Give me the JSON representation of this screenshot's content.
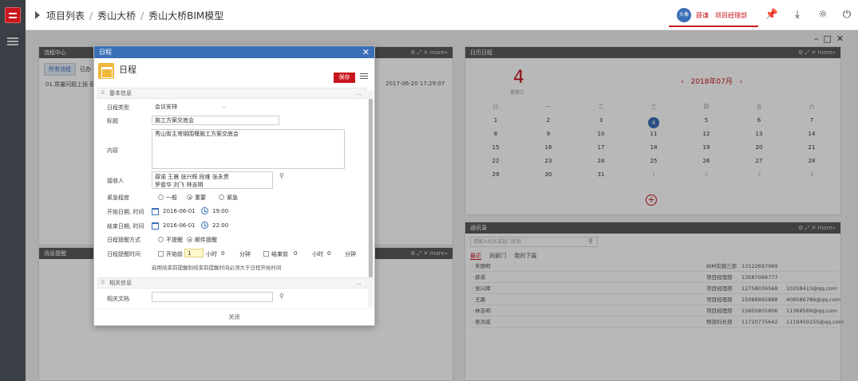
{
  "breadcrumb": [
    "项目列表",
    "秀山大桥",
    "秀山大桥BIM模型"
  ],
  "user": {
    "avatar": "头像",
    "name": "薛谦",
    "role": "项目经理部"
  },
  "header_icons": [
    "pin-icon",
    "download-icon",
    "bulb-icon",
    "power-icon"
  ],
  "colors": {
    "brand_red": "#c8161d",
    "accent_blue": "#3b6fb6",
    "rail_bg": "#3a3f46"
  },
  "process_panel": {
    "title": "流程中心",
    "tabs": [
      "所有流程",
      "已办"
    ],
    "row_text": "01.质量问题上报 薛",
    "row_date": "2017-06-20  17:29:07"
  },
  "remind_panel": {
    "title": "消息提醒"
  },
  "panel_tools": "⚙ ⤢ ✕ more»",
  "calendar": {
    "title": "日历日程",
    "day": "4",
    "weekday": "星期三",
    "month_label": "2018年07月",
    "weekdays": [
      "日",
      "一",
      "二",
      "三",
      "四",
      "五",
      "六"
    ],
    "weeks": [
      [
        "1",
        "2",
        "3",
        "4",
        "5",
        "6",
        "7"
      ],
      [
        "8",
        "9",
        "10",
        "11",
        "12",
        "13",
        "14"
      ],
      [
        "15",
        "16",
        "17",
        "18",
        "19",
        "20",
        "21"
      ],
      [
        "22",
        "23",
        "24",
        "25",
        "26",
        "27",
        "28"
      ],
      [
        "29",
        "30",
        "31",
        "1",
        "2",
        "3",
        "4"
      ]
    ],
    "today": "4"
  },
  "contacts": {
    "title": "通讯录",
    "search_placeholder": "请输入姓名或部门名称",
    "tabs": [
      "最近",
      "同部门",
      "我的下属"
    ],
    "rows": [
      {
        "name": "朱丽明",
        "dept": "BIM实施三部",
        "phone": "13122697069",
        "email": ""
      },
      {
        "name": "薛诺",
        "dept": "项目经理部",
        "phone": "13587066777",
        "email": ""
      },
      {
        "name": "张兴辉",
        "dept": "项目经理部",
        "phone": "12758036568",
        "email": "10258413@qq.com"
      },
      {
        "name": "王晨",
        "dept": "项目经理部",
        "phone": "15088895888",
        "email": "408586786@qq.com"
      },
      {
        "name": "林吉明",
        "dept": "项目经理部",
        "phone": "15605801806",
        "email": "11368569@qq.com"
      },
      {
        "name": "吴洪威",
        "dept": "物资科长部",
        "phone": "11720775642",
        "email": "1119459155@qq.com"
      }
    ]
  },
  "dialog": {
    "bar_title": "日程",
    "title": "日程",
    "save_label": "保存",
    "section_basic": "基本信息",
    "section_related": "相关信息",
    "fields": {
      "type_label": "日程类型",
      "type_value": "会议安排",
      "title_label": "标题",
      "title_value": "施工方案交底会",
      "content_label": "内容",
      "content_value": "秀山街主塔钢围堰施工方案交底会",
      "receivers_label": "接收人",
      "receivers_line1": "薛诺    王晨    张兴辉    段维    张永贵",
      "receivers_line2": "罗俊华    刘飞    林吉明",
      "urgency_label": "紧急程度",
      "urgency_options": [
        "一般",
        "重要",
        "紧急"
      ],
      "urgency_selected": "重要",
      "start_label": "开始日期, 时间",
      "start_date": "2016-06-01",
      "start_time": "19:00",
      "end_label": "结束日期, 时间",
      "end_date": "2016-06-01",
      "end_time": "22:00",
      "remind_mode_label": "日程提醒方式",
      "remind_modes": [
        "不提醒",
        "邮件提醒"
      ],
      "remind_mode_selected": "邮件提醒",
      "remind_time_label": "日程提醒时间",
      "before_start": "开始前",
      "before_start_hours": "1",
      "hour_unit": "小时",
      "before_start_minutes": "0",
      "minute_unit": "分钟",
      "before_end": "结束前",
      "before_end_hours": "0",
      "before_end_minutes": "0",
      "remind_note": "启用结束前提醒则结束前提醒时间必须大于日程开始时间",
      "related_doc_label": "相关文档"
    },
    "close_label": "关闭"
  }
}
